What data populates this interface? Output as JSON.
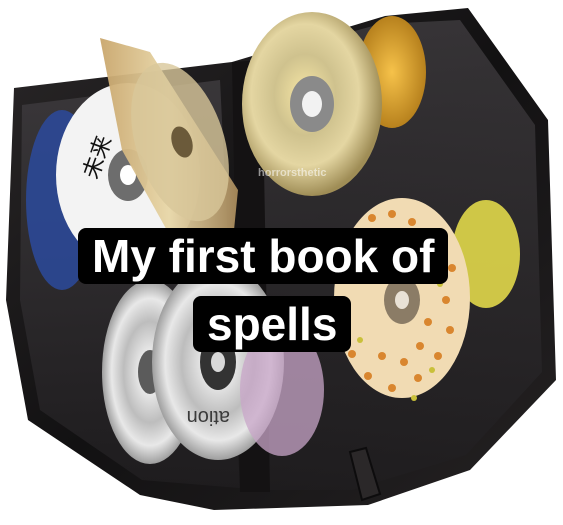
{
  "caption": {
    "line1": "My first book of",
    "line2": "spells"
  },
  "watermark": "horrorsthetic",
  "disc_labels": {
    "kanji": "未来",
    "rotated_text": "ation"
  },
  "colors": {
    "case_leather": "#1d1b1c",
    "sleeve": "#2e2b2e",
    "caption_background": "#000000",
    "caption_text": "#ffffff",
    "disc_silver": "#d6d6d6",
    "disc_gold": "#d9b45a",
    "polka_disc": "#f0d9b0",
    "polka_dot": "#d9862f"
  }
}
